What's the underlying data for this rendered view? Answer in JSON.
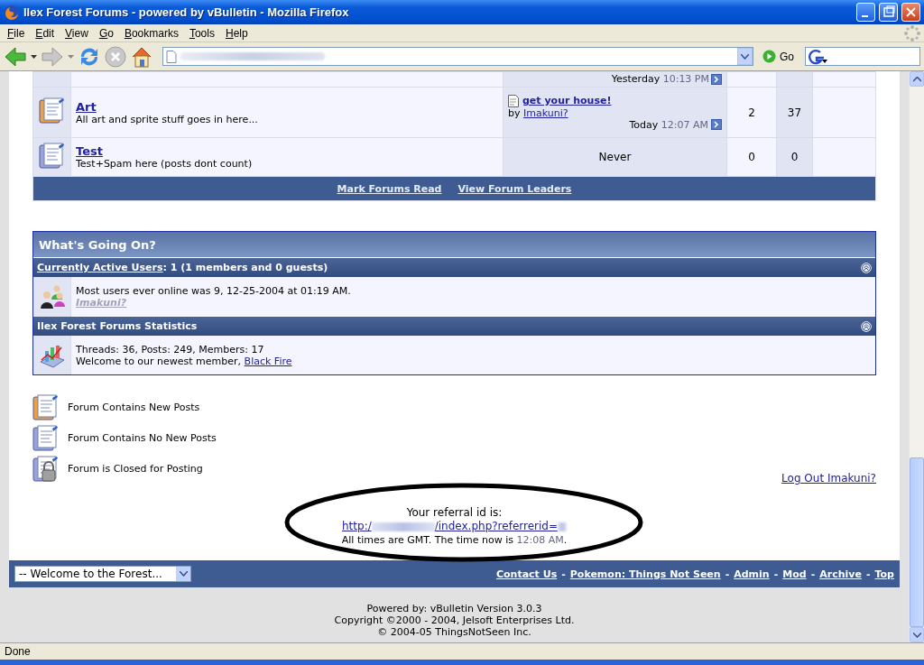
{
  "window": {
    "title": "Ilex Forest Forums - powered by vBulletin - Mozilla Firefox"
  },
  "menu": [
    "File",
    "Edit",
    "View",
    "Go",
    "Bookmarks",
    "Tools",
    "Help"
  ],
  "toolbar": {
    "go_label": "Go"
  },
  "forum_table": {
    "partial_row": {
      "day": "Yesterday",
      "time": "10:13 PM"
    },
    "rows": [
      {
        "kind": "new",
        "name": "Art",
        "description": "All art and sprite stuff goes in here...",
        "last_post": {
          "kind": "post",
          "title": "get your house!",
          "by": "by",
          "author": "Imakuni?",
          "day": "Today",
          "time": "12:07 AM"
        },
        "threads": "2",
        "posts": "37"
      },
      {
        "kind": "old",
        "name": "Test",
        "description": "Test+Spam here (posts dont count)",
        "last_post": {
          "kind": "never",
          "text": "Never"
        },
        "threads": "0",
        "posts": "0"
      }
    ],
    "footer_links": [
      "Mark Forums Read",
      "View Forum Leaders"
    ]
  },
  "whats_going_on": {
    "title": "What's Going On?",
    "sections": [
      {
        "kind": "users",
        "expanded": true,
        "header_link": "Currently Active Users",
        "header_rest": ": 1 (1 members and 0 guests)",
        "line": "Most users ever online was 9, 12-25-2004 at 01:19 AM.",
        "user": "Imakuni?"
      },
      {
        "kind": "stats",
        "expanded": true,
        "header": "Ilex Forest Forums Statistics",
        "line": "Threads: 36, Posts: 249, Members: 17",
        "welcome": "Welcome to our newest member, ",
        "member": "Black Fire"
      }
    ]
  },
  "legend": [
    {
      "kind": "new",
      "text": "Forum Contains New Posts"
    },
    {
      "kind": "old",
      "text": "Forum Contains No New Posts"
    },
    {
      "kind": "closed",
      "text": "Forum is Closed for Posting"
    }
  ],
  "logout_link": "Log Out Imakuni?",
  "referral": {
    "label": "Your referral id is:",
    "url_start": "http:/",
    "url_end": "/index.php?referrerid=",
    "time_text": "All times are GMT. The time now is ",
    "time": "12:08 AM",
    "time_end": "."
  },
  "footer": {
    "jump": "-- Welcome to the Forest...",
    "separator": "-",
    "links": [
      "Contact Us",
      "Pokemon: Things Not Seen",
      "Admin",
      "Mod",
      "Archive",
      "Top"
    ]
  },
  "copyright": [
    "Powered by: vBulletin Version 3.0.3",
    "Copyright ©2000 - 2004, Jelsoft Enterprises Ltd.",
    "© 2004-05 ThingsNotSeen Inc."
  ],
  "status_bar": "Done"
}
